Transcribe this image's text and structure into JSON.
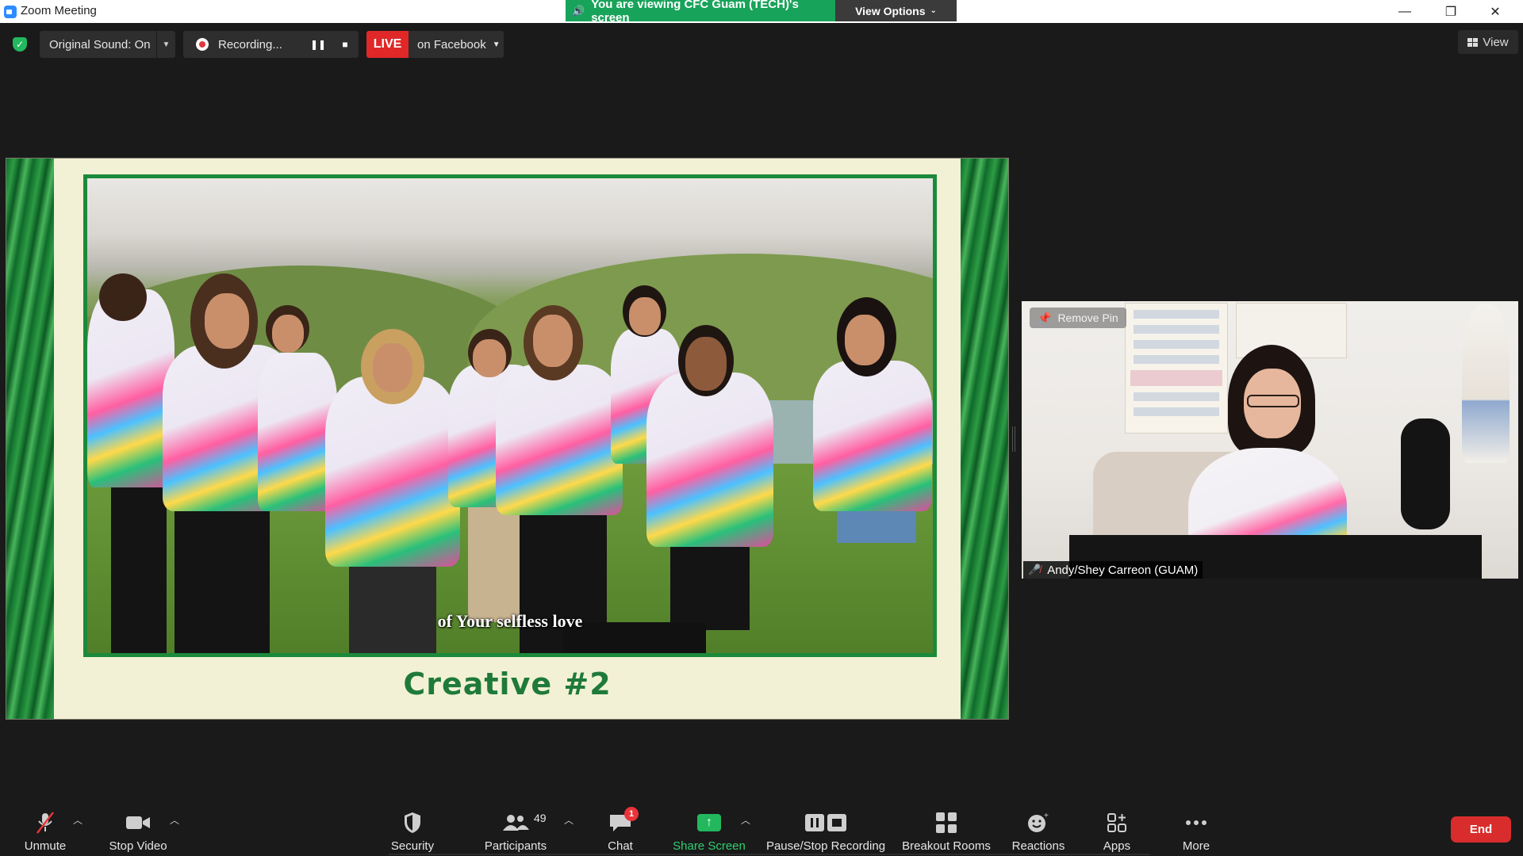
{
  "window": {
    "title": "Zoom Meeting",
    "controls": {
      "minimize": "—",
      "restore": "❐",
      "close": "✕"
    }
  },
  "share_banner": {
    "text": "You are viewing CFC Guam (TECH)'s screen",
    "view_options": "View Options",
    "color": "#18a35a"
  },
  "top_toolbar": {
    "original_sound": "Original Sound: On",
    "recording": "Recording...",
    "live": "LIVE",
    "live_destination": "on Facebook",
    "view": "View"
  },
  "shared_screen": {
    "lyric": "of Your selfless love",
    "title": "Creative #2"
  },
  "participant_tile": {
    "remove_pin": "Remove Pin",
    "name": "Andy/Shey Carreon (GUAM)"
  },
  "bottom_toolbar": {
    "unmute": "Unmute",
    "stop_video": "Stop Video",
    "security": "Security",
    "participants": "Participants",
    "participant_count": "49",
    "chat": "Chat",
    "chat_badge": "1",
    "share_screen": "Share Screen",
    "pause_stop_recording": "Pause/Stop Recording",
    "breakout_rooms": "Breakout Rooms",
    "reactions": "Reactions",
    "apps": "Apps",
    "more": "More",
    "end": "End"
  },
  "colors": {
    "background": "#1a1a1a",
    "live_red": "#e02828",
    "end_red": "#d92d2d",
    "share_green": "#23b85e"
  }
}
